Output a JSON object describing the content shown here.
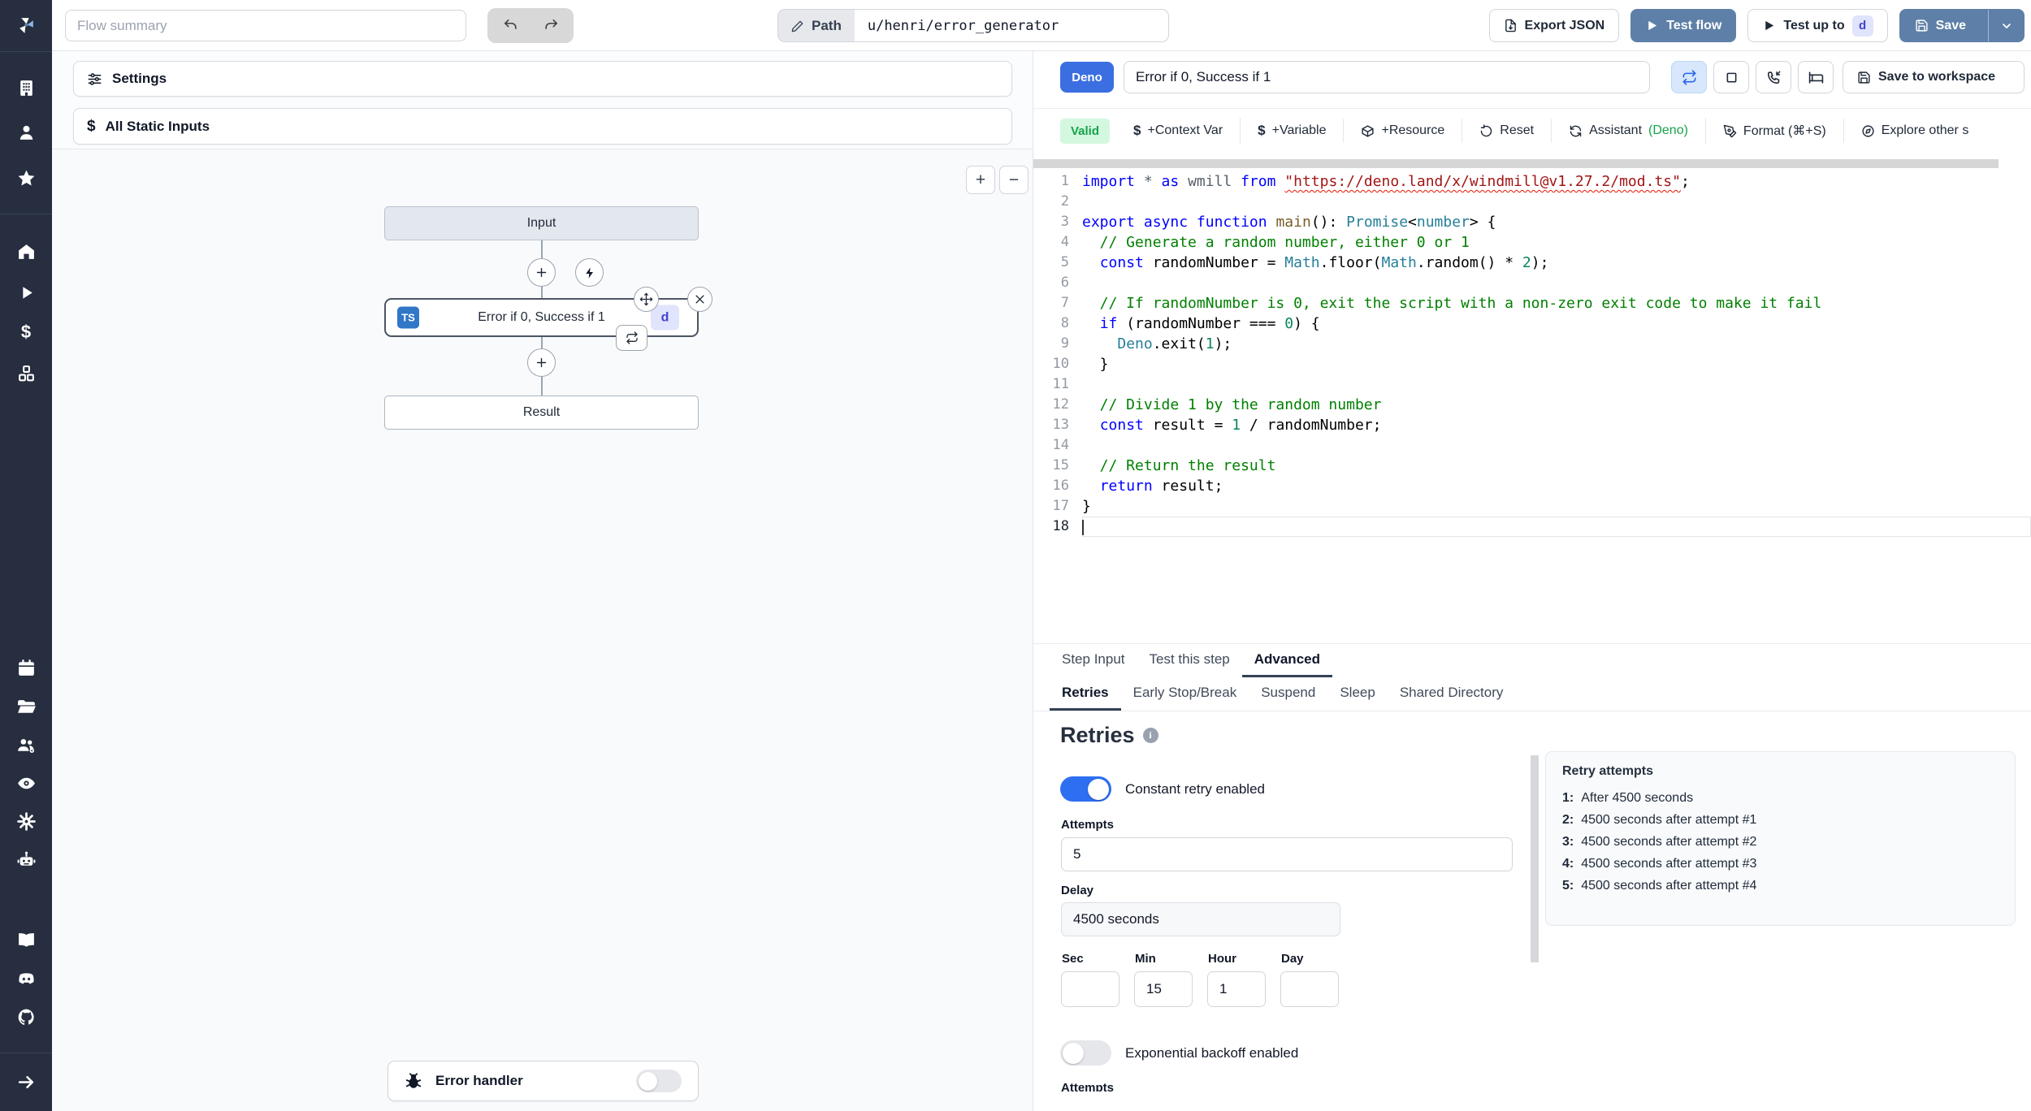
{
  "topbar": {
    "flow_summary_placeholder": "Flow summary",
    "path_label": "Path",
    "path_value": "u/henri/error_generator",
    "export_json_label": "Export JSON",
    "test_flow_label": "Test flow",
    "test_up_to_label": "Test up to",
    "test_up_to_badge": "d",
    "save_label": "Save"
  },
  "left_panel": {
    "settings_label": "Settings",
    "static_inputs_label": "All Static Inputs",
    "static_inputs_icon": "$",
    "zoom_in": "+",
    "zoom_out": "−",
    "flow": {
      "input_node": "Input",
      "step": {
        "lang_badge": "TS",
        "title": "Error if 0, Success if 1",
        "suffix_badge": "d"
      },
      "result_node": "Result"
    },
    "error_handler_label": "Error handler"
  },
  "editor": {
    "lang_badge": "Deno",
    "step_name": "Error if 0, Success if 1",
    "save_to_workspace_label": "Save to workspace",
    "toolbar": {
      "valid": "Valid",
      "dollar": "$",
      "context_var": "+Context Var",
      "variable": "+Variable",
      "resource": "+Resource",
      "reset": "Reset",
      "assistant": "Assistant",
      "assistant_lang": "(Deno)",
      "format": "Format (⌘+S)",
      "explore": "Explore other s"
    },
    "code": {
      "active_line": 18,
      "lines": [
        {
          "n": 1,
          "t": [
            [
              "kw",
              "import"
            ],
            [
              "dim",
              " * "
            ],
            [
              "kw",
              "as"
            ],
            [
              "dim",
              " wmill "
            ],
            [
              "kw",
              "from"
            ],
            [
              "pl",
              " "
            ],
            [
              "strsq",
              "\"https://deno.land/x/windmill@v1.27.2/mod.ts\""
            ],
            [
              "pl",
              ";"
            ]
          ]
        },
        {
          "n": 2,
          "t": []
        },
        {
          "n": 3,
          "t": [
            [
              "kw",
              "export"
            ],
            [
              "pl",
              " "
            ],
            [
              "kw",
              "async"
            ],
            [
              "pl",
              " "
            ],
            [
              "kw",
              "function"
            ],
            [
              "pl",
              " "
            ],
            [
              "fn",
              "main"
            ],
            [
              "pl",
              "(): "
            ],
            [
              "typ",
              "Promise"
            ],
            [
              "pl",
              "<"
            ],
            [
              "typ",
              "number"
            ],
            [
              "pl",
              "> {"
            ]
          ]
        },
        {
          "n": 4,
          "t": [
            [
              "com",
              "  // Generate a random number, either 0 or 1"
            ]
          ]
        },
        {
          "n": 5,
          "t": [
            [
              "pl",
              "  "
            ],
            [
              "kw",
              "const"
            ],
            [
              "pl",
              " randomNumber = "
            ],
            [
              "typ",
              "Math"
            ],
            [
              "pl",
              ".floor("
            ],
            [
              "typ",
              "Math"
            ],
            [
              "pl",
              ".random() * "
            ],
            [
              "num",
              "2"
            ],
            [
              "pl",
              ");"
            ]
          ]
        },
        {
          "n": 6,
          "t": []
        },
        {
          "n": 7,
          "t": [
            [
              "com",
              "  // If randomNumber is 0, exit the script with a non-zero exit code to make it fail"
            ]
          ]
        },
        {
          "n": 8,
          "t": [
            [
              "pl",
              "  "
            ],
            [
              "kw",
              "if"
            ],
            [
              "pl",
              " (randomNumber === "
            ],
            [
              "num",
              "0"
            ],
            [
              "pl",
              ") {"
            ]
          ]
        },
        {
          "n": 9,
          "t": [
            [
              "pl",
              "    "
            ],
            [
              "typ",
              "Deno"
            ],
            [
              "pl",
              ".exit("
            ],
            [
              "num",
              "1"
            ],
            [
              "pl",
              ");"
            ]
          ]
        },
        {
          "n": 10,
          "t": [
            [
              "pl",
              "  }"
            ]
          ]
        },
        {
          "n": 11,
          "t": []
        },
        {
          "n": 12,
          "t": [
            [
              "com",
              "  // Divide 1 by the random number"
            ]
          ]
        },
        {
          "n": 13,
          "t": [
            [
              "pl",
              "  "
            ],
            [
              "kw",
              "const"
            ],
            [
              "pl",
              " result = "
            ],
            [
              "num",
              "1"
            ],
            [
              "pl",
              " / randomNumber;"
            ]
          ]
        },
        {
          "n": 14,
          "t": []
        },
        {
          "n": 15,
          "t": [
            [
              "com",
              "  // Return the result"
            ]
          ]
        },
        {
          "n": 16,
          "t": [
            [
              "pl",
              "  "
            ],
            [
              "kw",
              "return"
            ],
            [
              "pl",
              " result;"
            ]
          ]
        },
        {
          "n": 17,
          "t": [
            [
              "pl",
              "}"
            ]
          ]
        },
        {
          "n": 18,
          "t": []
        }
      ]
    }
  },
  "panel_tabs": {
    "main": [
      "Step Input",
      "Test this step",
      "Advanced"
    ],
    "sub": [
      "Retries",
      "Early Stop/Break",
      "Suspend",
      "Sleep",
      "Shared Directory"
    ]
  },
  "retries": {
    "title": "Retries",
    "constant_toggle_label": "Constant retry enabled",
    "attempts_label": "Attempts",
    "attempts_value": "5",
    "delay_label": "Delay",
    "delay_value": "4500 seconds",
    "units": [
      {
        "label": "Sec",
        "value": ""
      },
      {
        "label": "Min",
        "value": "15"
      },
      {
        "label": "Hour",
        "value": "1"
      },
      {
        "label": "Day",
        "value": ""
      }
    ],
    "exponential_toggle_label": "Exponential backoff enabled",
    "clipped_label": "Attempts",
    "panel": {
      "title": "Retry attempts",
      "items": [
        {
          "n": "1:",
          "text": "After 4500 seconds"
        },
        {
          "n": "2:",
          "text": "4500 seconds after attempt #1"
        },
        {
          "n": "3:",
          "text": "4500 seconds after attempt #2"
        },
        {
          "n": "4:",
          "text": "4500 seconds after attempt #3"
        },
        {
          "n": "5:",
          "text": "4500 seconds after attempt #4"
        }
      ]
    }
  },
  "colors": {
    "rail_bg": "#262e3f",
    "steel_blue": "#5e80a8",
    "accent_blue": "#3b6fe1",
    "toggle_blue": "#2e6ff2",
    "valid_green": "#16a34a",
    "comment_green": "#008000",
    "keyword_blue": "#0000ff",
    "string_red": "#a31515"
  }
}
